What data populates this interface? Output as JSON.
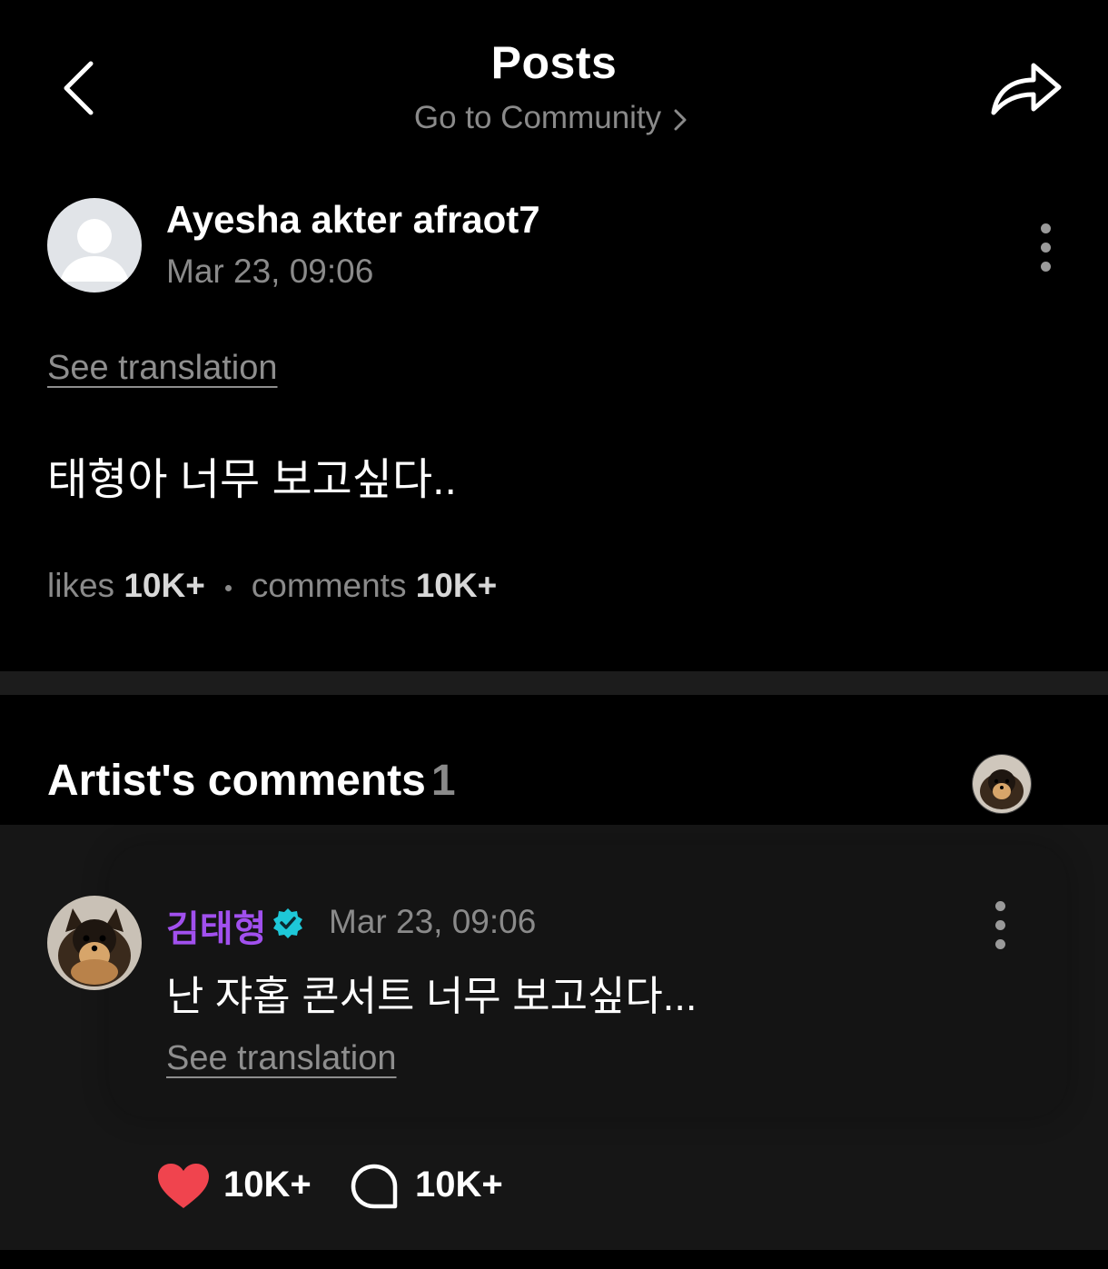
{
  "header": {
    "title": "Posts",
    "community_link": "Go to Community"
  },
  "post": {
    "author": "Ayesha akter afraot7",
    "date": "Mar 23, 09:06",
    "see_translation": "See translation",
    "body": "태형아 너무 보고싶다..",
    "stats": {
      "likes_label": "likes",
      "likes_value": "10K+",
      "comments_label": "comments",
      "comments_value": "10K+"
    }
  },
  "artist_comments": {
    "heading": "Artist's comments",
    "count": "1",
    "comment": {
      "author": "김태형",
      "verified": true,
      "date": "Mar 23, 09:06",
      "text": "난 쟈홉 콘서트 너무 보고싶다...",
      "see_translation": "See translation",
      "likes": "10K+",
      "replies": "10K+"
    }
  },
  "colors": {
    "background": "#000000",
    "muted_text": "#8a8a8a",
    "artist_name": "#a150ee",
    "verified_badge": "#1ec8d8",
    "like_heart": "#f0444e"
  },
  "icons": [
    "back-arrow-icon",
    "share-icon",
    "chevron-right-icon",
    "more-vertical-icon",
    "verified-badge-icon",
    "heart-icon",
    "comment-bubble-icon",
    "default-user-icon"
  ]
}
